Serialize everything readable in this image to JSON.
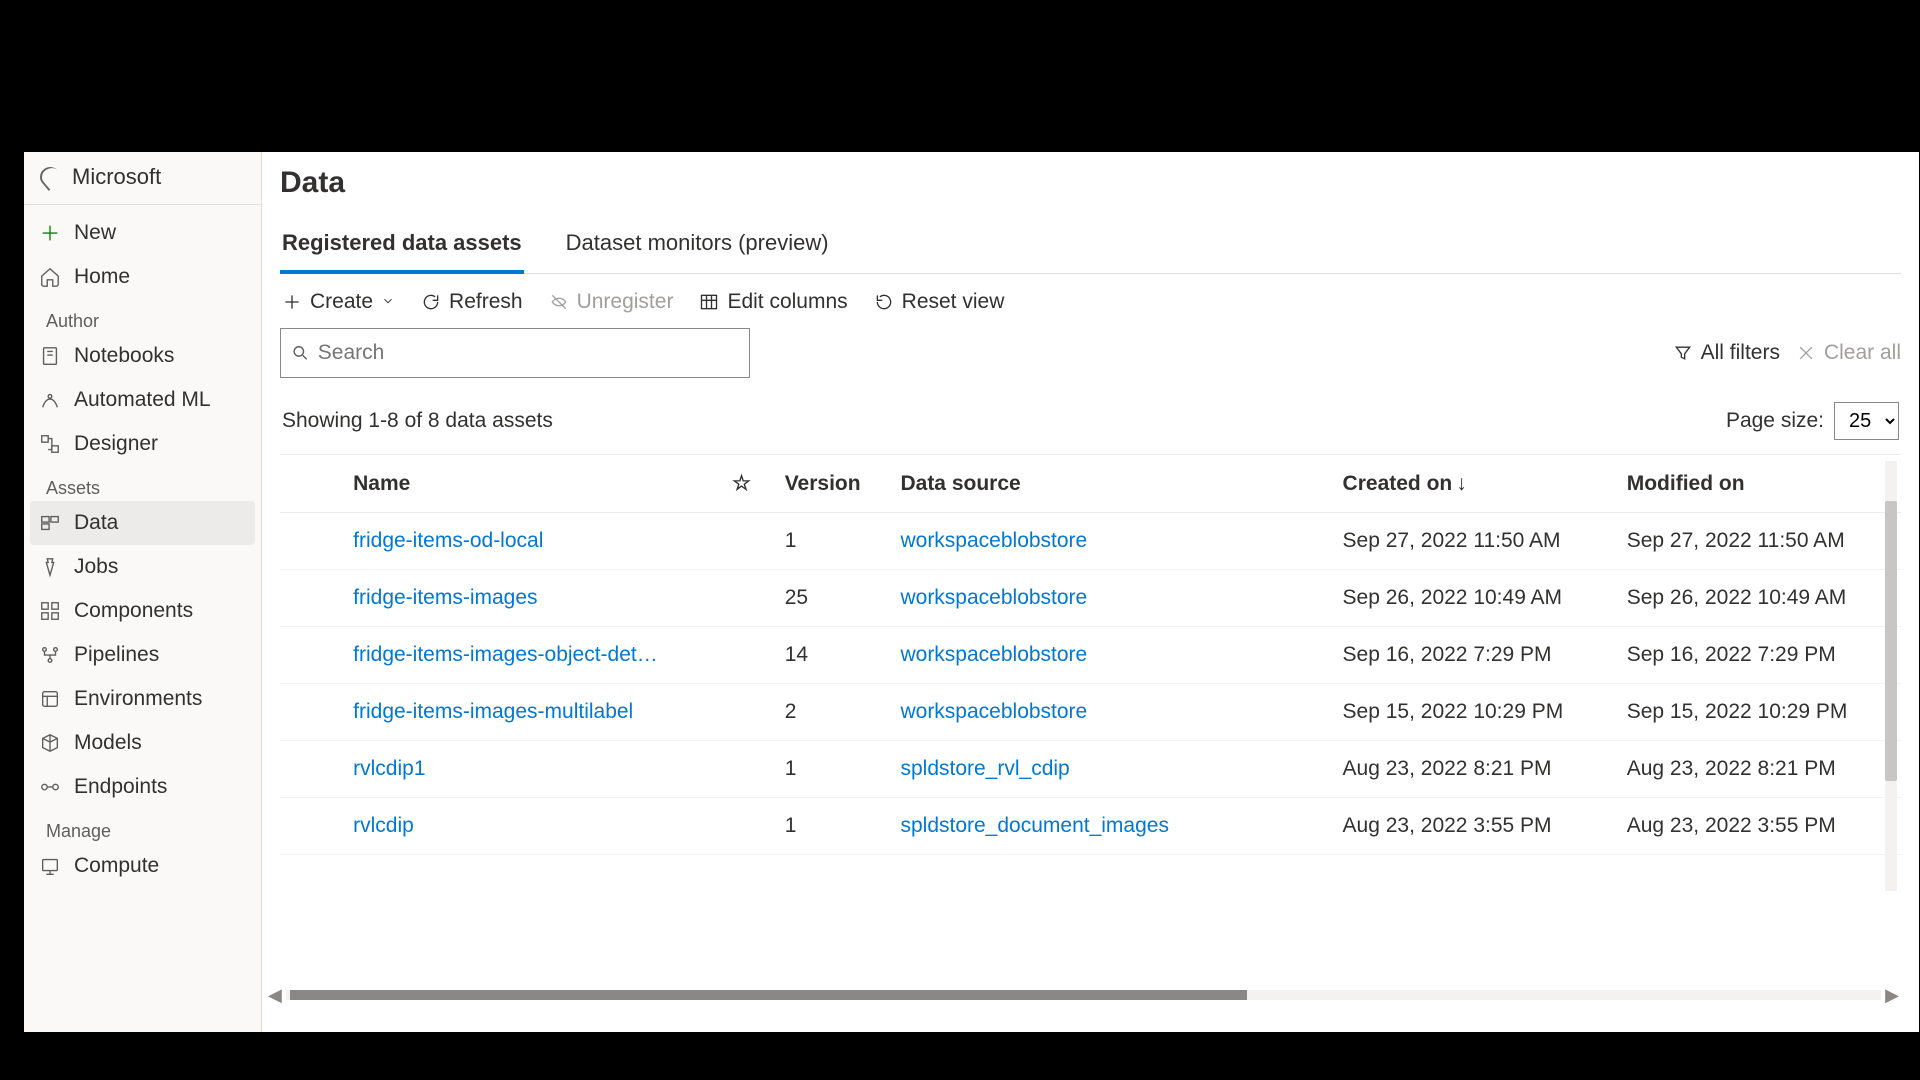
{
  "workspace": "Microsoft",
  "sidebar": {
    "new": "New",
    "home": "Home",
    "sections": {
      "author": "Author",
      "assets": "Assets",
      "manage": "Manage"
    },
    "items": {
      "notebooks": "Notebooks",
      "automl": "Automated ML",
      "designer": "Designer",
      "data": "Data",
      "jobs": "Jobs",
      "components": "Components",
      "pipelines": "Pipelines",
      "environments": "Environments",
      "models": "Models",
      "endpoints": "Endpoints",
      "compute": "Compute"
    }
  },
  "page_title": "Data",
  "tabs": {
    "registered": "Registered data assets",
    "monitors": "Dataset monitors (preview)"
  },
  "toolbar": {
    "create": "Create",
    "refresh": "Refresh",
    "unregister": "Unregister",
    "edit_columns": "Edit columns",
    "reset_view": "Reset view"
  },
  "search_placeholder": "Search",
  "filters": {
    "all": "All filters",
    "clear": "Clear all"
  },
  "results_summary": "Showing 1-8 of 8 data assets",
  "page_size_label": "Page size:",
  "page_size_value": "25",
  "columns": {
    "name": "Name",
    "version": "Version",
    "data_source": "Data source",
    "created_on": "Created on",
    "modified_on": "Modified on"
  },
  "rows": [
    {
      "name": "fridge-items-od-local",
      "version": "1",
      "source": "workspaceblobstore",
      "created": "Sep 27, 2022 11:50 AM",
      "modified": "Sep 27, 2022 11:50 AM"
    },
    {
      "name": "fridge-items-images",
      "version": "25",
      "source": "workspaceblobstore",
      "created": "Sep 26, 2022 10:49 AM",
      "modified": "Sep 26, 2022 10:49 AM"
    },
    {
      "name": "fridge-items-images-object-det…",
      "version": "14",
      "source": "workspaceblobstore",
      "created": "Sep 16, 2022 7:29 PM",
      "modified": "Sep 16, 2022 7:29 PM"
    },
    {
      "name": "fridge-items-images-multilabel",
      "version": "2",
      "source": "workspaceblobstore",
      "created": "Sep 15, 2022 10:29 PM",
      "modified": "Sep 15, 2022 10:29 PM"
    },
    {
      "name": "rvlcdip1",
      "version": "1",
      "source": "spldstore_rvl_cdip",
      "created": "Aug 23, 2022 8:21 PM",
      "modified": "Aug 23, 2022 8:21 PM"
    },
    {
      "name": "rvlcdip",
      "version": "1",
      "source": "spldstore_document_images",
      "created": "Aug 23, 2022 3:55 PM",
      "modified": "Aug 23, 2022 3:55 PM"
    }
  ]
}
